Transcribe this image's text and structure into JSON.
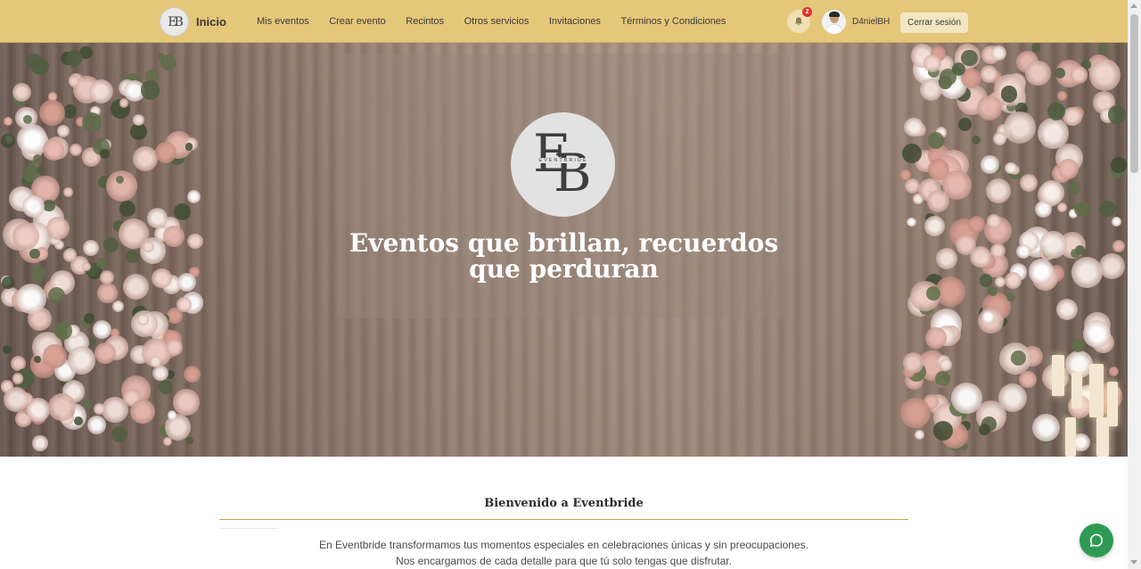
{
  "navbar": {
    "logo_text": "EB",
    "home_label": "Inicio",
    "links": [
      "Mis eventos",
      "Crear evento",
      "Recintos",
      "Otros servicios",
      "Invitaciones",
      "Términos y Condiciones"
    ],
    "notification_count": "2",
    "notification_icon": "bell-icon",
    "username": "D4nielBH",
    "logout_label": "Cerrar sesión",
    "bg_color": "#e5c77a"
  },
  "hero": {
    "logo_letters": [
      "E",
      "B"
    ],
    "logo_subtitle": "EVENTBRIDE",
    "title": "Eventos que brillan, recuerdos que perduran"
  },
  "welcome": {
    "title": "Bienvenido a Eventbride",
    "lines": [
      "En Eventbride transformamos tus momentos especiales en celebraciones únicas y sin preocupaciones.",
      "Nos encargamos de cada detalle para que tú solo tengas que disfrutar."
    ],
    "accent_color": "#c9a94e"
  },
  "chat": {
    "icon": "chat-bubble-icon",
    "color": "#2e9a54"
  }
}
